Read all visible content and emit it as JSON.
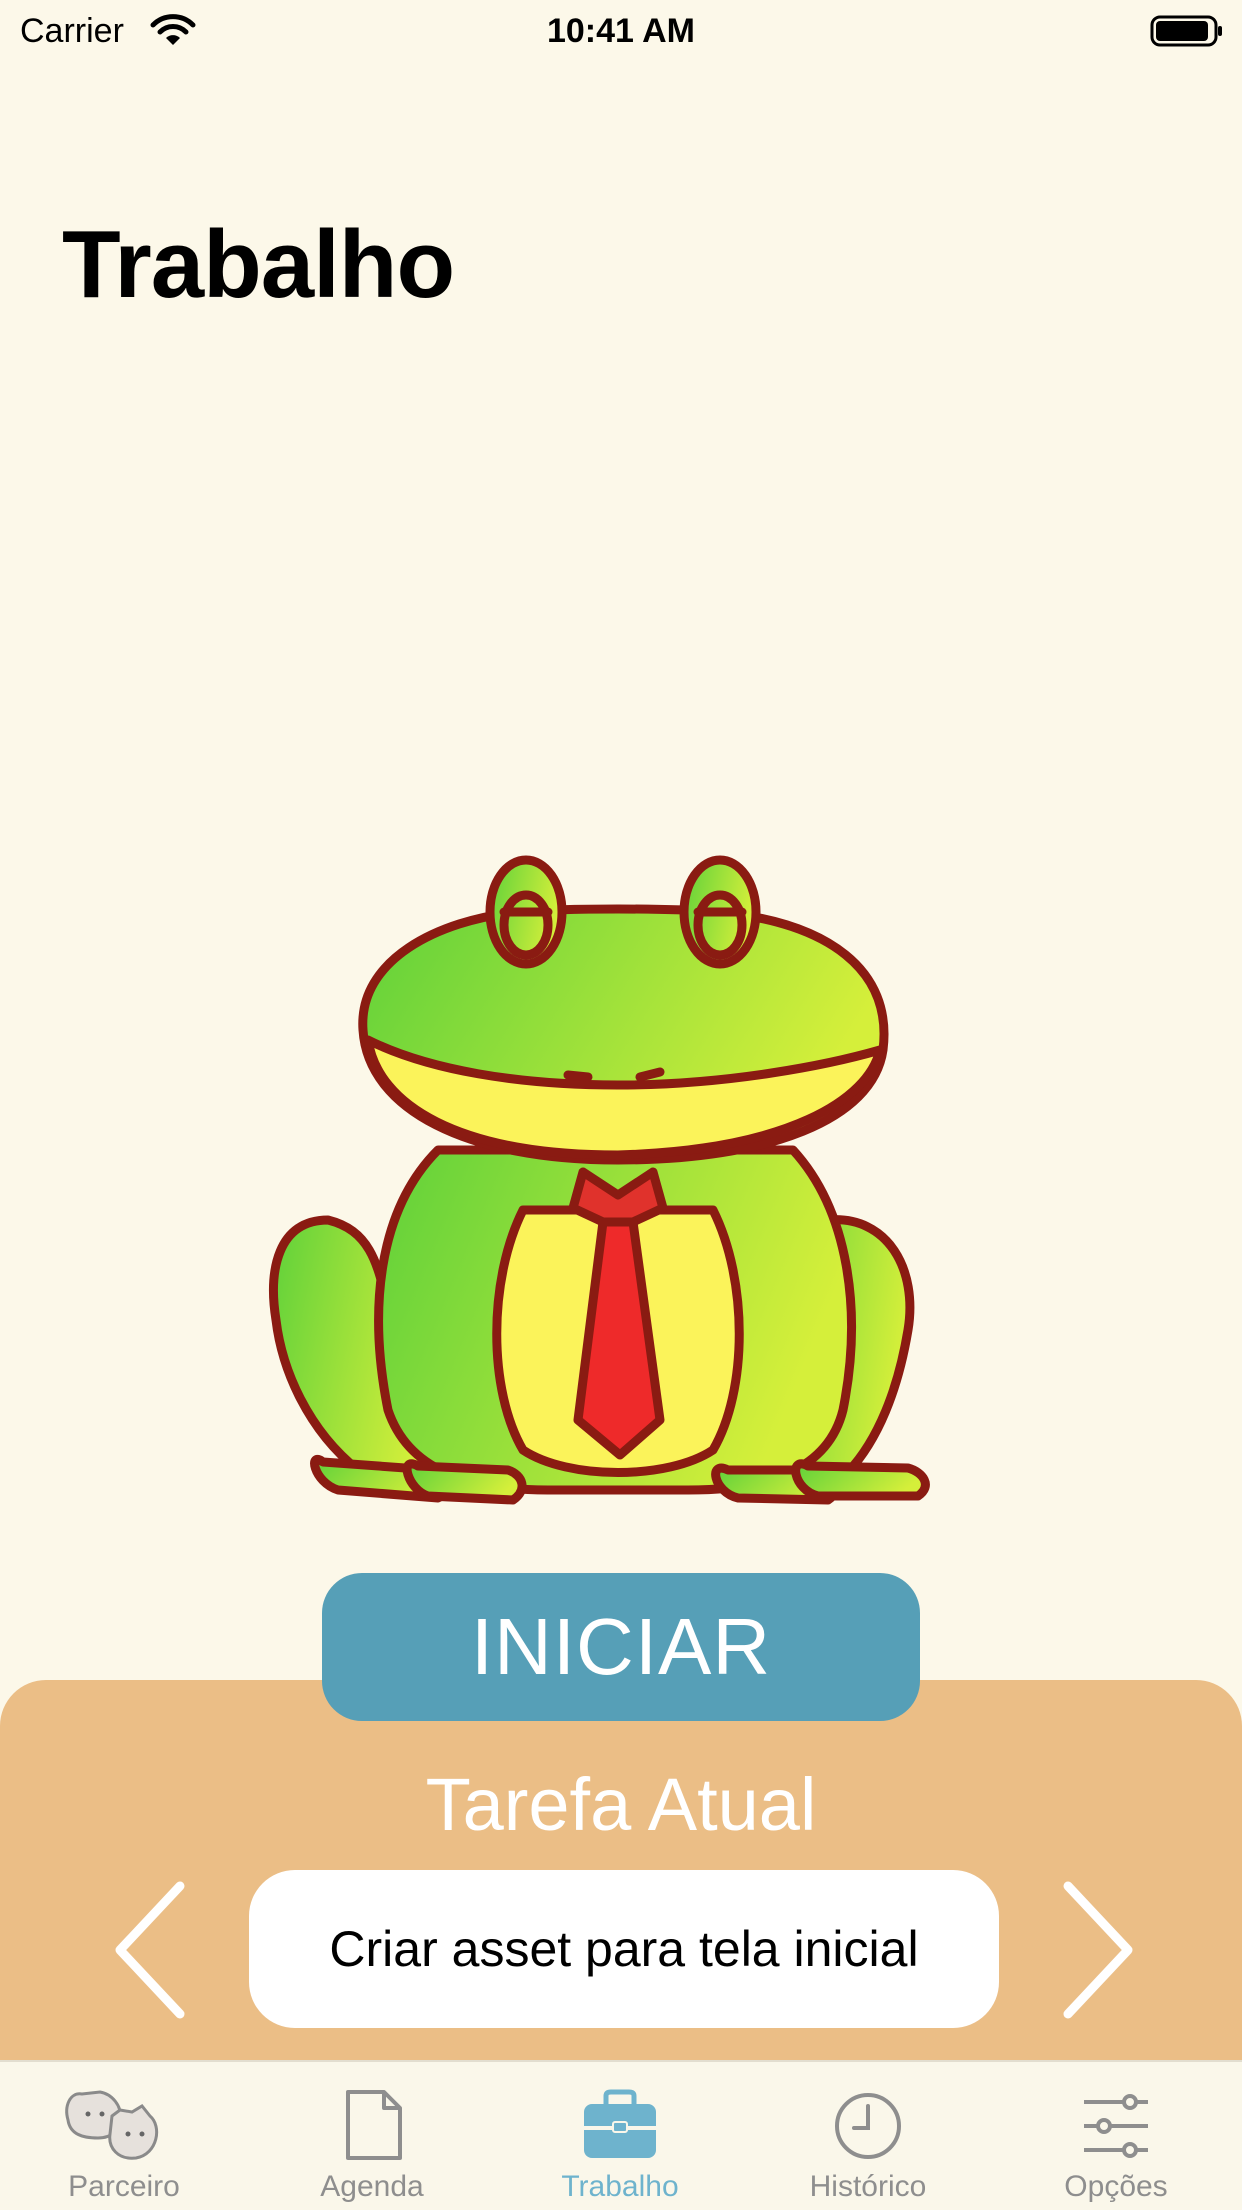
{
  "status_bar": {
    "carrier": "Carrier",
    "time": "10:41 AM"
  },
  "page": {
    "title": "Trabalho"
  },
  "mascot": {
    "icon": "frog-with-tie-illustration"
  },
  "start_button": {
    "label": "INICIAR",
    "color": "#569fb7"
  },
  "task_panel": {
    "heading": "Tarefa Atual",
    "current_task": "Criar asset para tela inicial",
    "background_color": "#ebbe86"
  },
  "tab_bar": {
    "active_color": "#6eb3cd",
    "tabs": [
      {
        "label": "Parceiro",
        "icon": "pets-icon",
        "active": false
      },
      {
        "label": "Agenda",
        "icon": "document-icon",
        "active": false
      },
      {
        "label": "Trabalho",
        "icon": "briefcase-icon",
        "active": true
      },
      {
        "label": "Histórico",
        "icon": "clock-icon",
        "active": false
      },
      {
        "label": "Opções",
        "icon": "sliders-icon",
        "active": false
      }
    ]
  }
}
